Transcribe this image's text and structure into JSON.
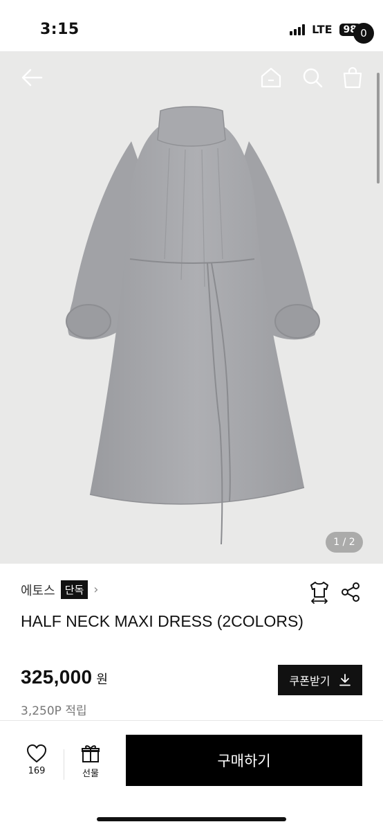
{
  "status_bar": {
    "time": "3:15",
    "network": "LTE",
    "battery": "98"
  },
  "header": {
    "icons": [
      "back-arrow-icon",
      "home-icon",
      "search-icon",
      "shopping-bag-icon"
    ],
    "cart_count": "0"
  },
  "gallery": {
    "page_indicator": "1 / 2",
    "current_page": 1,
    "total_pages": 2
  },
  "product": {
    "brand": "에토스",
    "exclusive_badge": "단독",
    "title": "HALF NECK MAXI DRESS (2COLORS)",
    "price": "325,000",
    "currency": "원",
    "points": "3,250P 적립",
    "icons": [
      "size-guide-icon",
      "share-icon"
    ]
  },
  "coupon": {
    "label": "쿠폰받기",
    "icon": "download-icon"
  },
  "bottom_bar": {
    "wish_count": "169",
    "gift_label": "선물",
    "buy_label": "구매하기"
  },
  "colors": {
    "accent": "#000000",
    "image_bg": "#e9e9e8",
    "dress": "#a5a6aa"
  }
}
